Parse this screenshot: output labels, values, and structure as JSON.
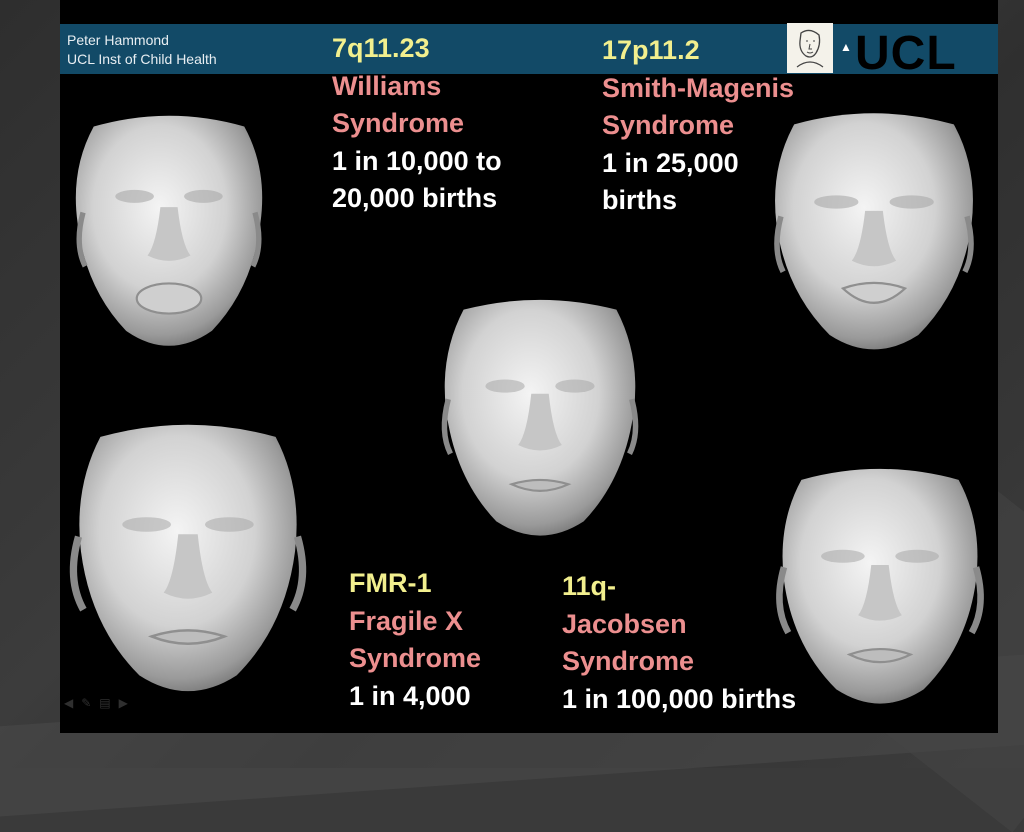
{
  "header": {
    "author_line1": "Peter Hammond",
    "author_line2": "UCL Inst of Child Health",
    "logo_text": "UCL",
    "logo_mark": "▲"
  },
  "williams": {
    "locus": "7q11.23",
    "name_line1": "Williams",
    "name_line2": "Syndrome",
    "freq_line1": "1 in 10,000 to",
    "freq_line2": "20,000 births"
  },
  "smith_magenis": {
    "locus": "17p11.2",
    "name_line1": "Smith-Magenis",
    "name_line2": "Syndrome",
    "freq_line1": "1 in 25,000",
    "freq_line2": "births"
  },
  "fragile_x": {
    "locus": "FMR-1",
    "name_line1": "Fragile X",
    "name_line2": "Syndrome",
    "freq_line1": "1 in 4,000"
  },
  "jacobsen": {
    "locus": "11q-",
    "name_line1": "Jacobsen",
    "name_line2": "Syndrome",
    "freq_line1": "1 in 100,000 births"
  },
  "colors": {
    "header_bar": "#124a67",
    "locus_yellow": "#f2ef8e",
    "name_pink": "#ec8f8f",
    "freq_white": "#ffffff"
  },
  "nav_icons": [
    "arrow-left-icon",
    "pen-icon",
    "slides-icon",
    "arrow-right-icon"
  ]
}
